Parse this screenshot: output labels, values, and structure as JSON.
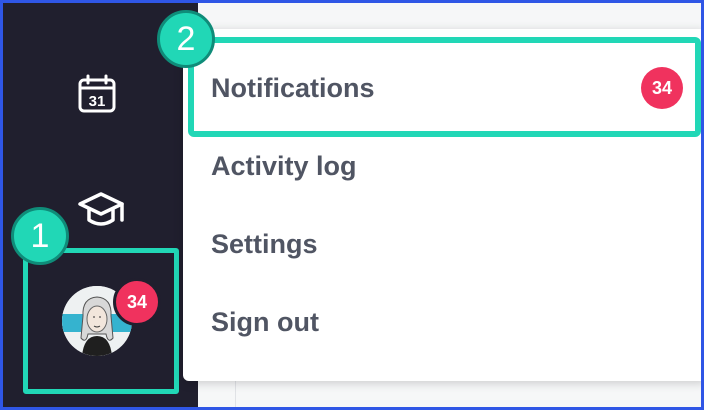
{
  "sidebar": {
    "icons": [
      {
        "name": "calendar-icon",
        "text": "31"
      },
      {
        "name": "graduation-cap-icon"
      }
    ],
    "avatar_badge": "34"
  },
  "steps": {
    "first": "1",
    "second": "2"
  },
  "menu": {
    "items": [
      {
        "label": "Notifications",
        "badge": "34"
      },
      {
        "label": "Activity log"
      },
      {
        "label": "Settings"
      },
      {
        "label": "Sign out"
      }
    ]
  },
  "colors": {
    "sidebar_bg": "#201f2e",
    "highlight": "#21d7b6",
    "badge": "#f0325e",
    "frame": "#2f56e6",
    "menu_text": "#505563"
  }
}
